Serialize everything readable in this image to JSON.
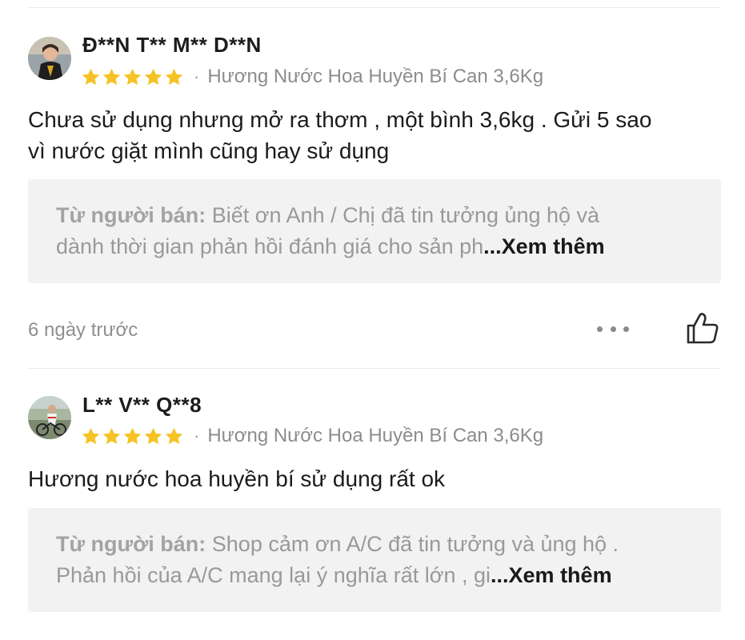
{
  "colors": {
    "star": "#F6C224",
    "seller_box_bg": "#F2F2F2",
    "muted_text": "#8C8C8C"
  },
  "reviews": [
    {
      "username": "Đ**N T** M** D**N",
      "rating": 5,
      "separator": "·",
      "variant": "Hương Nước Hoa Huyền Bí Can 3,6Kg",
      "text_line1": "Chưa sử dụng nhưng mở ra thơm , một bình 3,6kg . Gửi 5 sao",
      "text_line2": "vì nước giặt mình cũng hay sử dụng",
      "seller_label": "Từ người bán:",
      "seller_line1": " Biết ơn Anh / Chị đã tin tưởng ủng hộ và",
      "seller_line2": "dành thời gian phản hồi đánh giá cho sản ph",
      "see_more": "...Xem thêm",
      "time": "6 ngày trước",
      "avatar_icon": "user-avatar-photo"
    },
    {
      "username": "L** V** Q**8",
      "rating": 5,
      "separator": "·",
      "variant": "Hương Nước Hoa Huyền Bí Can 3,6Kg",
      "text_line1": "Hương nước hoa huyền bí sử dụng rất ok",
      "seller_label": "Từ người bán:",
      "seller_line1": " Shop cảm ơn A/C đã tin tưởng và ủng hộ .",
      "seller_line2": "Phản hồi của A/C mang lại ý nghĩa rất lớn , gi",
      "see_more": "...Xem thêm",
      "avatar_icon": "user-avatar-photo"
    }
  ],
  "icons": {
    "more": "more-dots-icon",
    "like": "thumbs-up-icon",
    "star": "star-icon"
  }
}
